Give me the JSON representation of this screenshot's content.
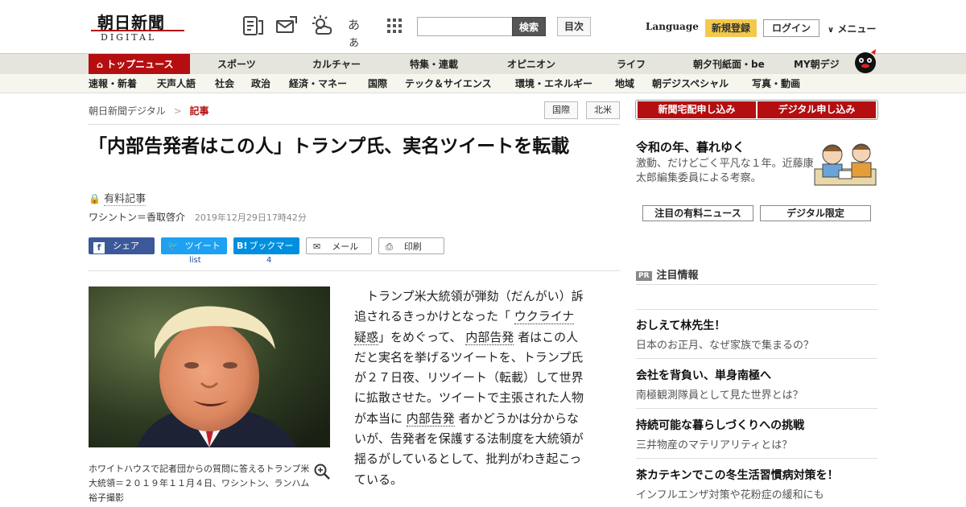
{
  "header": {
    "logo_ja": "朝日新聞",
    "logo_en": "DIGITAL",
    "kana_icon": "あぁ",
    "search_label": "検索",
    "search_placeholder": "",
    "toc_label": "目次",
    "language_label": "Language",
    "register_label": "新規登録",
    "login_label": "ログイン",
    "menu_label": "メニュー",
    "icons": [
      "newspaper-icon",
      "mail-news-icon",
      "weather-icon",
      "font-size-icon",
      "grid-menu-icon"
    ]
  },
  "nav_main": {
    "items": [
      "トップニュース",
      "スポーツ",
      "カルチャー",
      "特集・連載",
      "オピニオン",
      "ライフ",
      "朝夕刊紙面・be",
      "MY朝デジ"
    ]
  },
  "nav_sub": {
    "items": [
      "速報・新着",
      "天声人語",
      "社会",
      "政治",
      "経済・マネー",
      "国際",
      "テック＆サイエンス",
      "環境・エネルギー",
      "地域",
      "朝デジスペシャル",
      "写真・動画"
    ]
  },
  "breadcrumb": {
    "home": "朝日新聞デジタル",
    "sep": ">",
    "current": "記事"
  },
  "tags": [
    "国際",
    "北米"
  ],
  "article": {
    "title": "「内部告発者はこの人」トランプ氏、実名ツイートを転載",
    "paid_label": "有料記事",
    "author": "ワシントン＝香取啓介",
    "date": "2019年12月29日17時42分",
    "share": {
      "facebook": "シェア",
      "twitter": "ツイート",
      "twitter_count": "list",
      "hatena": "ブックマーク",
      "hatena_count": "4",
      "mail": "メール",
      "print": "印刷"
    },
    "caption": "ホワイトハウスで記者団からの質問に答えるトランプ米大統領＝２０１９年１１月４日、ワシントン、ランハム裕子撮影",
    "body_lines": [
      {
        "pre": "トランプ米大統領が弾劾（だんがい）訴",
        "indent": true
      },
      {
        "pre": "追されるきっかけとなった「",
        "link": "ウクライナ"
      },
      {
        "link": "疑惑",
        "post": "」をめぐって、"
      },
      {
        "link2": "内部告発",
        "post": "者はこの人"
      },
      {
        "pre": "だと実名を挙げるツイートを、トランプ氏"
      },
      {
        "pre": "が２７日夜、リツイート（転載）して世界"
      },
      {
        "pre": "に拡散させた。ツイートで主張された人物"
      },
      {
        "pre": "が本当に",
        "link": "内部告発",
        "post": "者かどうかは分からな"
      },
      {
        "pre": "いが、告発者を保護する法制度を大統領が"
      },
      {
        "pre": "揺るがしているとして、批判がわき起こっ"
      },
      {
        "pre": "ている。"
      }
    ]
  },
  "sidebar": {
    "subscribe_paper": "新聞宅配申し込み",
    "subscribe_digital": "デジタル申し込み",
    "feature_title": "令和の年、暮れゆく",
    "feature_text": "激動、だけどごく平凡な１年。近藤康太郎編集委員による考察。",
    "tab_paid": "注目の有料ニュース",
    "tab_digital": "デジタル限定",
    "pr_badge": "PR",
    "pr_heading": "注目情報",
    "pr_items": [
      {
        "title": "おしえて林先生！",
        "sub": "日本のお正月、なぜ家族で集まるの？"
      },
      {
        "title": "会社を背負い、単身南極へ",
        "sub": "南極観測隊員として見た世界とは？"
      },
      {
        "title": "持続可能な暮らしづくりへの挑戦",
        "sub": "三井物産のマテリアリティとは？"
      },
      {
        "title": "茶カテキンでこの冬生活習慣病対策を！",
        "sub": "インフルエンザ対策や花粉症の緩和にも"
      }
    ]
  },
  "colors": {
    "brand_red": "#b40e10",
    "register_yellow": "#f2c94c",
    "facebook": "#3b5998",
    "twitter": "#1da1f2",
    "hatena": "#008fde"
  }
}
